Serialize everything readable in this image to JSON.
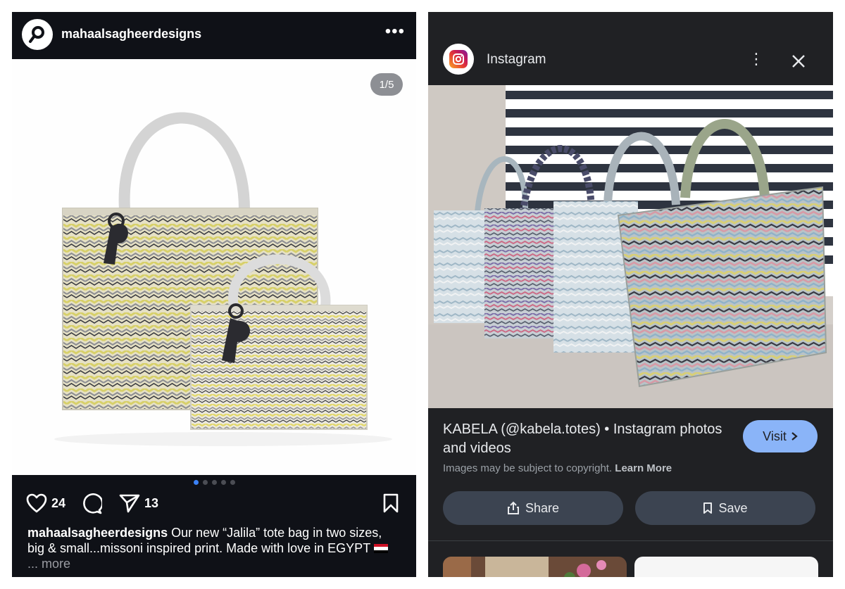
{
  "left": {
    "username": "mahaalsagheerdesigns",
    "counter": "1/5",
    "likes": "24",
    "shares": "13",
    "caption_user": "mahaalsagheerdesigns",
    "caption_text": " Our new “Jalila” tote bag in two sizes, big & small...missoni inspired print. Made with love in EGYPT ",
    "caption_more": "... more",
    "icons": [
      "logo-icon",
      "more-icon",
      "heart-icon",
      "comment-icon",
      "send-icon",
      "bookmark-icon"
    ],
    "dot_active_color": "#3b82f6"
  },
  "right": {
    "app_name": "Instagram",
    "result_title": "KABELA (@kabela.totes) • Instagram photos and videos",
    "visit_label": "Visit",
    "copyright_text": "Images may be subject to copyright.",
    "learn_more": "Learn More",
    "share_label": "Share",
    "save_label": "Save",
    "accent": "#8ab4f8",
    "icons": [
      "instagram-icon",
      "kebab-icon",
      "close-icon",
      "chevron-right-icon",
      "share-icon",
      "bookmark-icon"
    ]
  }
}
